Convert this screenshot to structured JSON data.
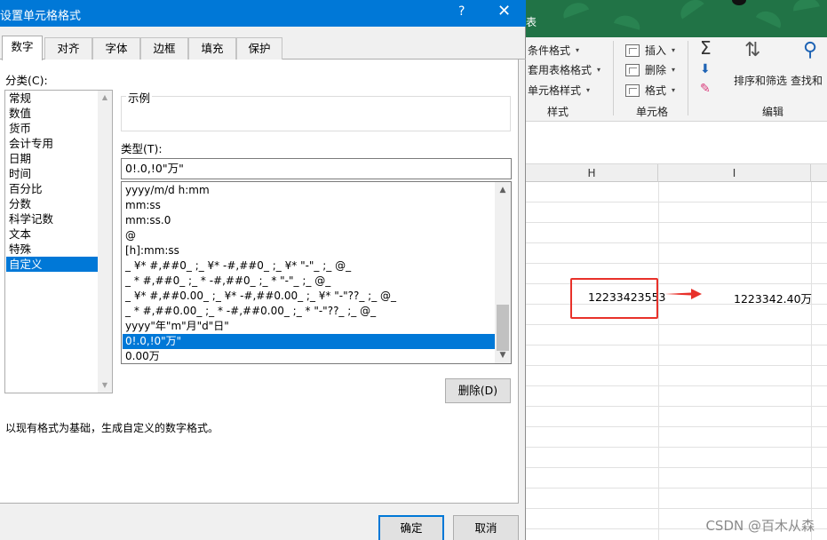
{
  "dialog": {
    "title": "设置单元格格式",
    "help": "?",
    "close": "✕",
    "tabs": [
      "数字",
      "对齐",
      "字体",
      "边框",
      "填充",
      "保护"
    ],
    "active_tab": "数字",
    "category_label": "分类(C):",
    "categories": [
      "常规",
      "数值",
      "货币",
      "会计专用",
      "日期",
      "时间",
      "百分比",
      "分数",
      "科学记数",
      "文本",
      "特殊",
      "自定义"
    ],
    "selected_category": "自定义",
    "sample_label": "示例",
    "sample_value": "",
    "type_label": "类型(T):",
    "type_value": "0!.0,!0\"万\"",
    "formats": [
      "yyyy/m/d h:mm",
      "mm:ss",
      "mm:ss.0",
      "@",
      "[h]:mm:ss",
      "_ ¥* #,##0_ ;_ ¥* -#,##0_ ;_ ¥* \"-\"_ ;_ @_",
      "_ * #,##0_ ;_ * -#,##0_ ;_ * \"-\"_ ;_ @_",
      "_ ¥* #,##0.00_ ;_ ¥* -#,##0.00_ ;_ ¥* \"-\"??_ ;_ @_",
      "_ * #,##0.00_ ;_ * -#,##0.00_ ;_ * \"-\"??_ ;_ @_",
      "yyyy\"年\"m\"月\"d\"日\"",
      "0!.0,!0\"万\"",
      "0.00万"
    ],
    "selected_format": "0!.0,!0\"万\"",
    "delete_button": "删除(D)",
    "hint": "以现有格式为基础，生成自定义的数字格式。",
    "ok_button": "确定",
    "cancel_button": "取消"
  },
  "excel": {
    "title_fragment": "表",
    "ribbon": {
      "styles": {
        "items": [
          "条件格式",
          "套用表格格式",
          "单元格样式"
        ],
        "label": "样式"
      },
      "cells": {
        "items": [
          "插入",
          "删除",
          "格式"
        ],
        "label": "单元格"
      },
      "editing": {
        "sort_filter": "排序和筛选",
        "find_select": "查找和",
        "label": "编辑"
      }
    },
    "columns": [
      "H",
      "I"
    ],
    "cell_source": "12233423553",
    "cell_result": "1223342.40万",
    "accent_color": "#217346",
    "highlight_color": "#e8312a"
  },
  "watermark": "CSDN @百木从森"
}
